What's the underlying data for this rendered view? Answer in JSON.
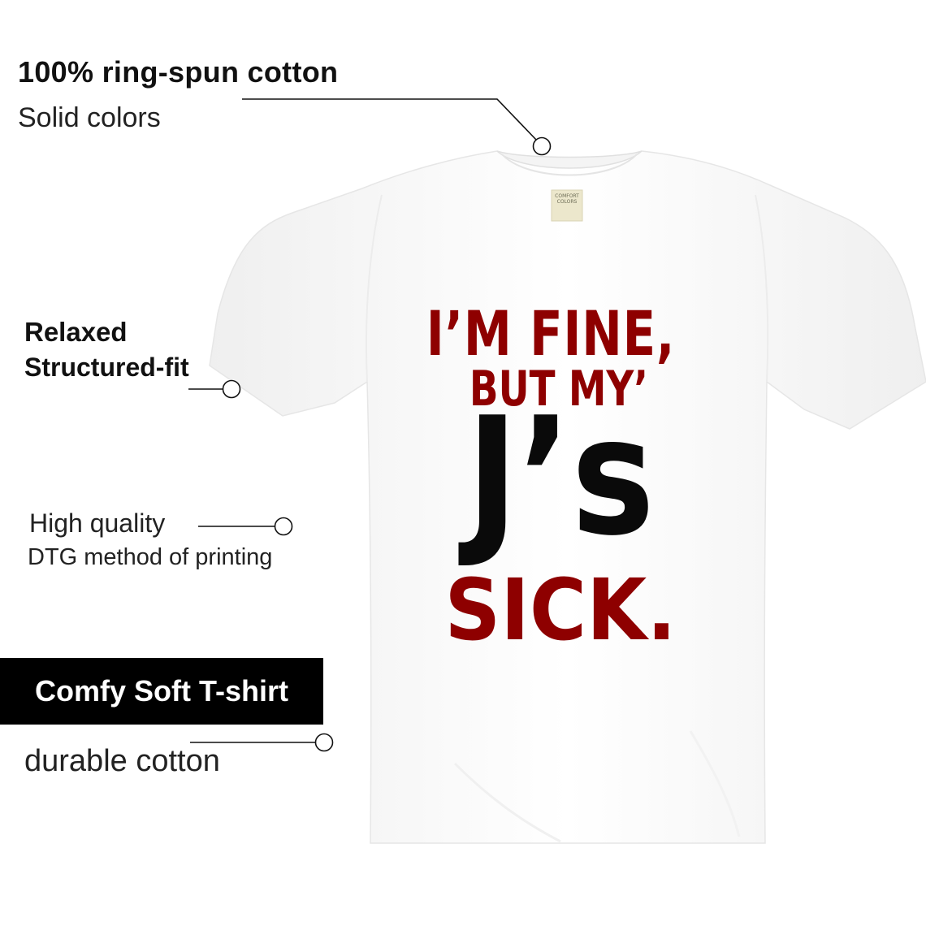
{
  "features": {
    "cotton_title": "100% ring-spun cotton",
    "cotton_sub": "Solid colors",
    "fit_title": "Relaxed",
    "fit_sub": "Structured-fit",
    "print_title": "High quality",
    "print_sub": "DTG method of printing",
    "comfy_label": "Comfy Soft T-shirt",
    "durable": "durable cotton"
  },
  "shirt": {
    "color": "#ffffff",
    "print_line1": "I’M FINE,",
    "print_line2": "BUT MY’",
    "print_line3": "J’s",
    "print_line4": "SICK.",
    "print_red": "#8e0000",
    "print_black": "#0a0a0a",
    "tag_text": "COMFORT COLORS"
  }
}
